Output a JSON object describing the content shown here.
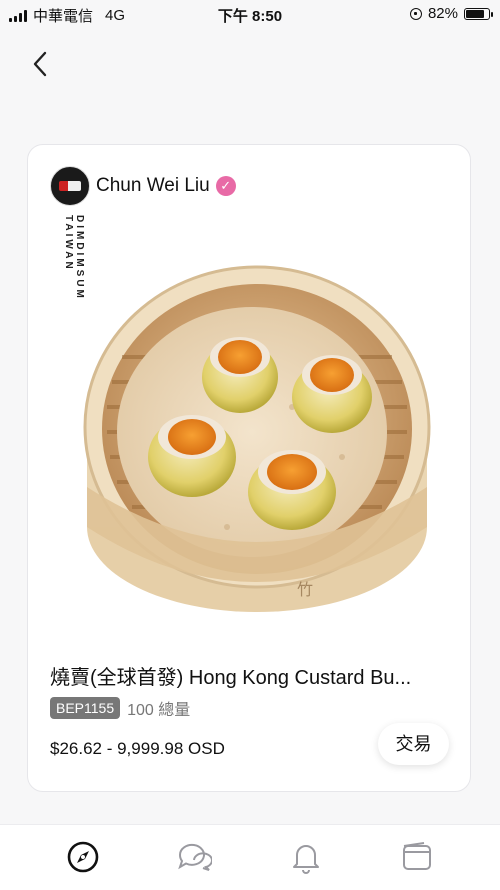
{
  "status_bar": {
    "carrier": "中華電信",
    "network": "4G",
    "time": "下午 8:50",
    "battery_percent": "82%",
    "battery_level": 0.82,
    "icons": [
      "signal-bars-icon",
      "orientation-lock-icon",
      "battery-icon"
    ]
  },
  "nav": {
    "back_icon": "chevron-left-icon"
  },
  "card": {
    "creator_name": "Chun Wei Liu",
    "verified_icon": "verified-badge-icon",
    "watermark_lines": [
      "DIMDIMSUM",
      "TAIWAN"
    ],
    "title": "燒賣(全球首發) Hong Kong Custard Bu...",
    "token_code": "BEP1155",
    "supply": "100 總量",
    "price": "$26.62 - 9,999.98 OSD",
    "action_label": "交易"
  },
  "bottom_nav": {
    "items": [
      {
        "icon": "compass-icon",
        "active": true
      },
      {
        "icon": "chat-bubbles-icon",
        "active": false
      },
      {
        "icon": "bell-icon",
        "active": false
      },
      {
        "icon": "wallet-icon",
        "active": false
      }
    ]
  },
  "colors": {
    "background": "#f7f7f8",
    "card": "#ffffff",
    "verified": "#e86aa6",
    "badge": "#777777"
  }
}
